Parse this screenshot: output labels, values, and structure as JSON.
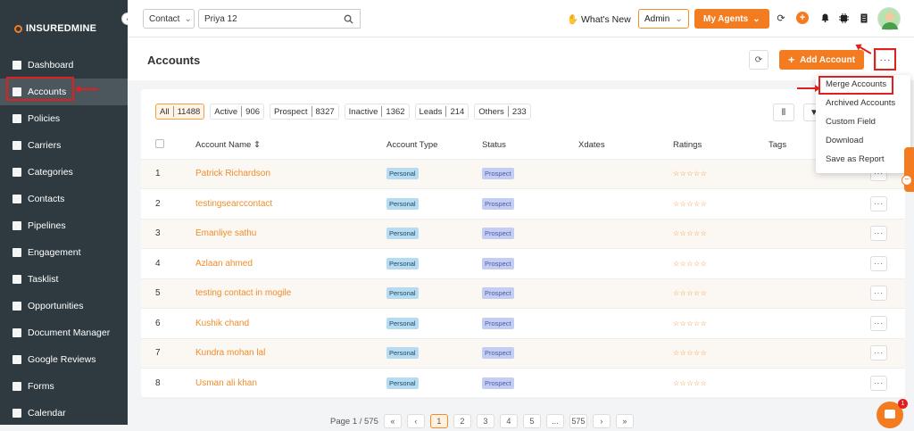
{
  "brand": {
    "bold": "INSUREDMINE",
    "thin": ""
  },
  "sidebar": {
    "collapse_glyph": "‹",
    "items": [
      {
        "label": "Dashboard",
        "icon": "dashboard-icon"
      },
      {
        "label": "Accounts",
        "icon": "accounts-icon",
        "active": true
      },
      {
        "label": "Policies",
        "icon": "policies-icon"
      },
      {
        "label": "Carriers",
        "icon": "carriers-icon"
      },
      {
        "label": "Categories",
        "icon": "categories-icon"
      },
      {
        "label": "Contacts",
        "icon": "contacts-icon"
      },
      {
        "label": "Pipelines",
        "icon": "pipelines-icon"
      },
      {
        "label": "Engagement",
        "icon": "engagement-icon"
      },
      {
        "label": "Tasklist",
        "icon": "tasklist-icon"
      },
      {
        "label": "Opportunities",
        "icon": "opportunities-icon"
      },
      {
        "label": "Document Manager",
        "icon": "document-manager-icon"
      },
      {
        "label": "Google Reviews",
        "icon": "google-reviews-icon"
      },
      {
        "label": "Forms",
        "icon": "forms-icon"
      },
      {
        "label": "Calendar",
        "icon": "calendar-icon"
      }
    ]
  },
  "topbar": {
    "search_type": "Contact",
    "search_value": "Priya 12",
    "whats_new": "What's New",
    "role": "Admin",
    "my_agents": "My Agents"
  },
  "page": {
    "title": "Accounts",
    "add_button": "Add Account",
    "more_glyph": "···"
  },
  "filters": [
    {
      "label": "All",
      "count": "11488",
      "active": true
    },
    {
      "label": "Active",
      "count": "906"
    },
    {
      "label": "Prospect",
      "count": "8327"
    },
    {
      "label": "Inactive",
      "count": "1362"
    },
    {
      "label": "Leads",
      "count": "214"
    },
    {
      "label": "Others",
      "count": "233"
    }
  ],
  "table": {
    "columns": [
      "Account Name",
      "Account Type",
      "Status",
      "Xdates",
      "Ratings",
      "Tags"
    ],
    "sort_glyph": "⇕",
    "rows": [
      {
        "num": "1",
        "name": "Patrick Richardson",
        "type": "Personal",
        "status": "Prospect"
      },
      {
        "num": "2",
        "name": "testingsearccontact",
        "type": "Personal",
        "status": "Prospect"
      },
      {
        "num": "3",
        "name": "Emanliye sathu",
        "type": "Personal",
        "status": "Prospect"
      },
      {
        "num": "4",
        "name": "Azlaan ahmed",
        "type": "Personal",
        "status": "Prospect"
      },
      {
        "num": "5",
        "name": "testing contact in mogile",
        "type": "Personal",
        "status": "Prospect"
      },
      {
        "num": "6",
        "name": "Kushik chand",
        "type": "Personal",
        "status": "Prospect"
      },
      {
        "num": "7",
        "name": "Kundra mohan lal",
        "type": "Personal",
        "status": "Prospect"
      },
      {
        "num": "8",
        "name": "Usman ali khan",
        "type": "Personal",
        "status": "Prospect"
      }
    ],
    "stars": "☆☆☆☆☆",
    "row_more": "···"
  },
  "dropdown": {
    "items": [
      "Merge Accounts",
      "Archived Accounts",
      "Custom Field",
      "Download",
      "Save as Report"
    ]
  },
  "pagination": {
    "label": "Page 1 / 575",
    "pages": [
      "«",
      "‹",
      "1",
      "2",
      "3",
      "4",
      "5",
      "...",
      "575",
      "›",
      "»"
    ],
    "current": "1"
  },
  "chat": {
    "badge": "1"
  },
  "colors": {
    "accent": "#f47c20",
    "sidebar": "#2e3a3f",
    "highlight": "#e02020"
  }
}
